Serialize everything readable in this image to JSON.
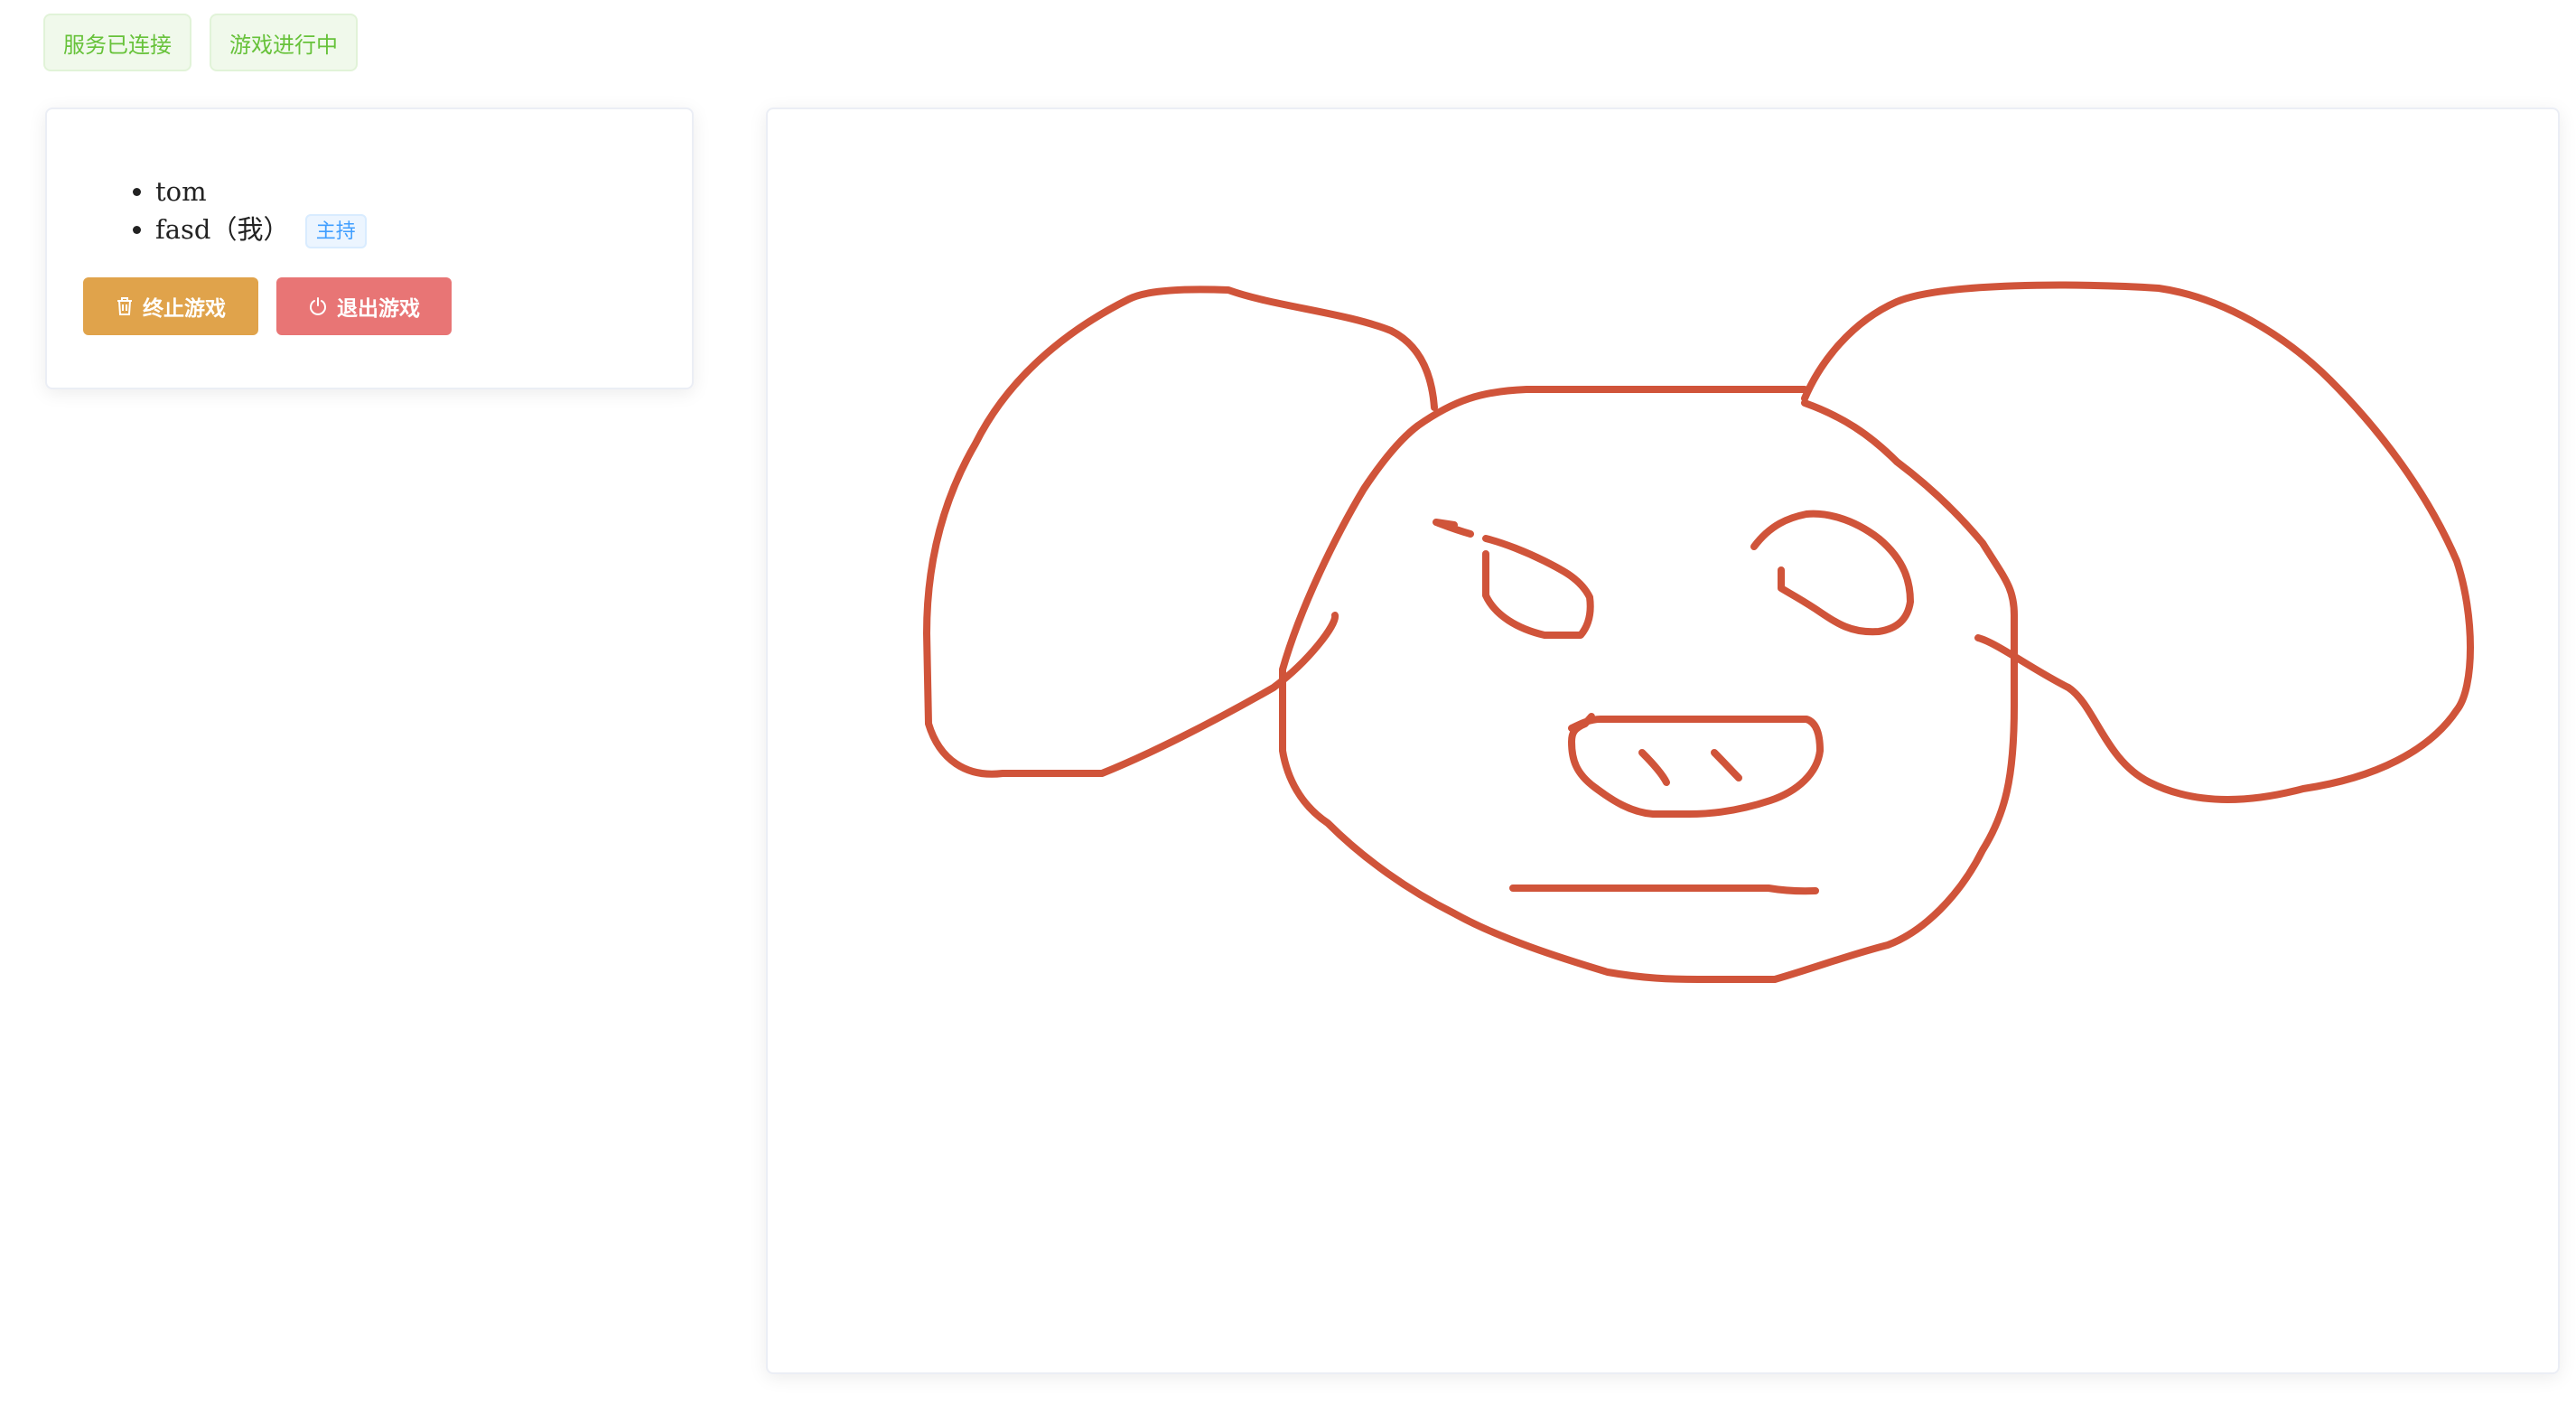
{
  "status": {
    "connection": "服务已连接",
    "game": "游戏进行中"
  },
  "players": [
    {
      "name": "tom"
    },
    {
      "name": "fasd（我）",
      "badge": "主持"
    }
  ],
  "actions": {
    "stop_label": "终止游戏",
    "exit_label": "退出游戏"
  },
  "canvas": {
    "stroke_color": "#d0543a",
    "drawing_subject": "pig face sketch"
  },
  "colors": {
    "success": "#67c23a",
    "primary": "#409eff",
    "warning": "#e0a34b",
    "danger": "#e87575"
  }
}
